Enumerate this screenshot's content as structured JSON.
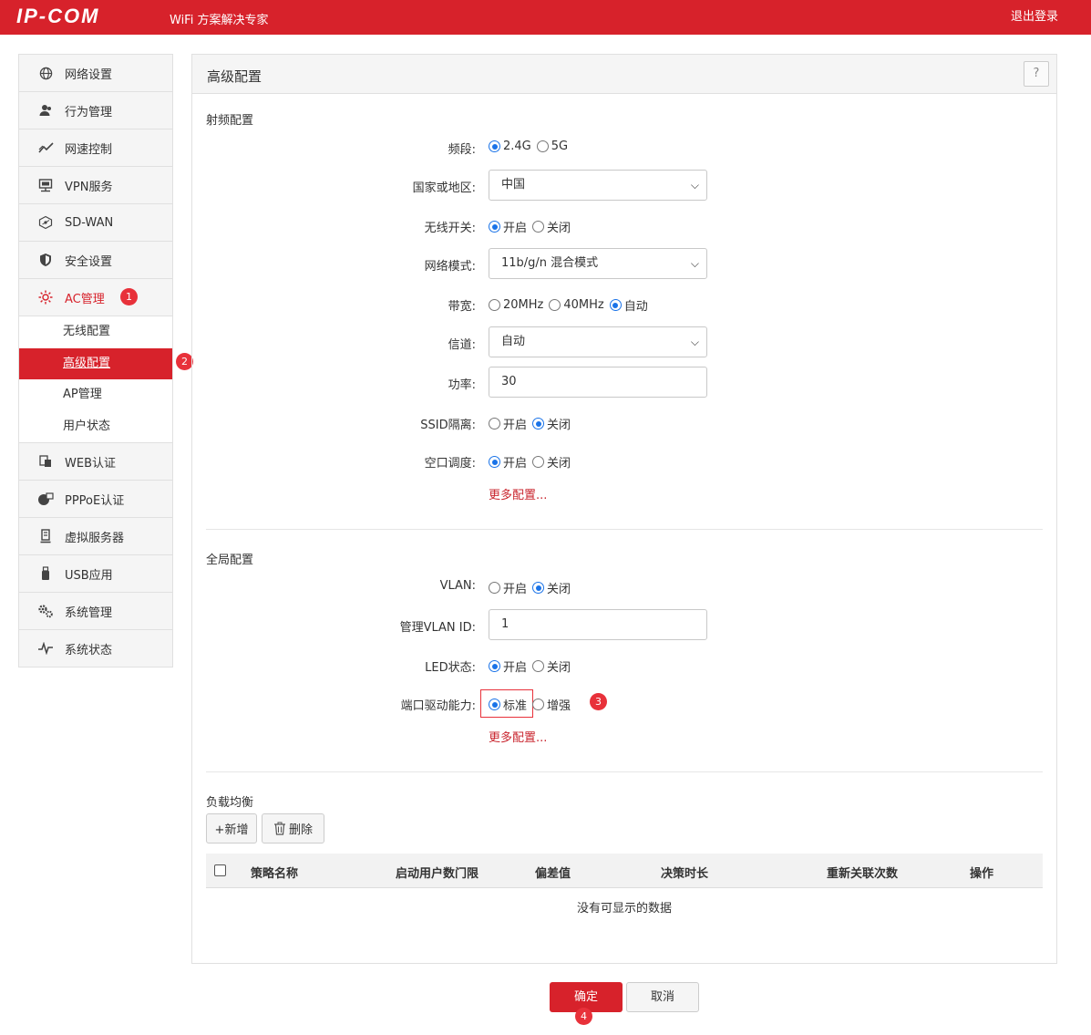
{
  "header": {
    "logo": "IP-COM",
    "tagline": "WiFi 方案解决专家",
    "logout": "退出登录",
    "brand_color": "#d7222b"
  },
  "sidebar": {
    "items": [
      {
        "label": "网络设置",
        "icon": "globe-icon"
      },
      {
        "label": "行为管理",
        "icon": "users-icon"
      },
      {
        "label": "网速控制",
        "icon": "trend-line-icon"
      },
      {
        "label": "VPN服务",
        "icon": "monitor-network-icon"
      },
      {
        "label": "SD-WAN",
        "icon": "sdwan-icon"
      },
      {
        "label": "安全设置",
        "icon": "shield-icon"
      },
      {
        "label": "AC管理",
        "icon": "gear-network-icon",
        "active": true,
        "badge": "1"
      },
      {
        "label": "WEB认证",
        "icon": "web-auth-icon"
      },
      {
        "label": "PPPoE认证",
        "icon": "pppoe-icon"
      },
      {
        "label": "虚拟服务器",
        "icon": "server-icon"
      },
      {
        "label": "USB应用",
        "icon": "usb-icon"
      },
      {
        "label": "系统管理",
        "icon": "gears-icon"
      },
      {
        "label": "系统状态",
        "icon": "pulse-icon"
      }
    ],
    "submenu": [
      {
        "label": "无线配置"
      },
      {
        "label": "高级配置",
        "active": true,
        "badge": "2"
      },
      {
        "label": "AP管理"
      },
      {
        "label": "用户状态"
      }
    ]
  },
  "panel": {
    "title": "高级配置",
    "help": "?"
  },
  "rf": {
    "section_title": "射频配置",
    "band_label": "频段:",
    "band_options": [
      "2.4G",
      "5G"
    ],
    "country_label": "国家或地区:",
    "country_value": "中国",
    "wireless_label": "无线开关:",
    "on": "开启",
    "off": "关闭",
    "mode_label": "网络模式:",
    "mode_value": "11b/g/n 混合模式",
    "bandwidth_label": "带宽:",
    "bandwidth_options": [
      "20MHz",
      "40MHz",
      "自动"
    ],
    "channel_label": "信道:",
    "channel_value": "自动",
    "power_label": "功率:",
    "power_value": "30",
    "ssid_iso_label": "SSID隔离:",
    "airtime_label": "空口调度:",
    "more": "更多配置..."
  },
  "global": {
    "section_title": "全局配置",
    "vlan_label": "VLAN:",
    "mgmt_vlan_label": "管理VLAN ID:",
    "mgmt_vlan_value": "1",
    "led_label": "LED状态:",
    "port_label": "端口驱动能力:",
    "port_options": [
      "标准",
      "增强"
    ],
    "badge": "3",
    "more": "更多配置..."
  },
  "load_balance": {
    "section_title": "负载均衡",
    "add": "+新增",
    "delete": "删除",
    "columns": [
      "策略名称",
      "启动用户数门限",
      "偏差值",
      "决策时长",
      "重新关联次数",
      "操作"
    ],
    "empty": "没有可显示的数据"
  },
  "footer": {
    "ok": "确定",
    "cancel": "取消",
    "badge": "4"
  }
}
